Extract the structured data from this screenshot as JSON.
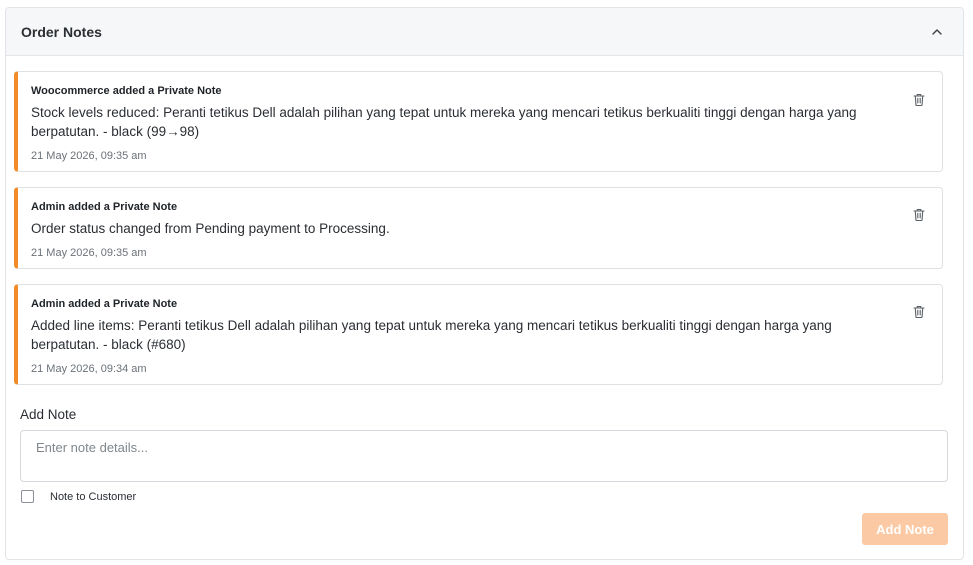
{
  "panel": {
    "title": "Order Notes"
  },
  "notes": [
    {
      "author": "Woocommerce added a Private Note",
      "text": "Stock levels reduced: Peranti tetikus Dell adalah pilihan yang tepat untuk mereka yang mencari tetikus berkualiti tinggi dengan harga yang berpatutan. - black (99→98)",
      "time": "21 May 2026, 09:35 am"
    },
    {
      "author": "Admin added a Private Note",
      "text": "Order status changed from Pending payment to Processing.",
      "time": "21 May 2026, 09:35 am"
    },
    {
      "author": "Admin added a Private Note",
      "text": "Added line items: Peranti tetikus Dell adalah pilihan yang tepat untuk mereka yang mencari tetikus berkualiti tinggi dengan harga yang berpatutan. - black (#680)",
      "time": "21 May 2026, 09:34 am"
    }
  ],
  "add_note": {
    "label": "Add Note",
    "placeholder": "Enter note details...",
    "value": "",
    "customer_checkbox_label": "Note to Customer",
    "customer_checked": false,
    "button_label": "Add Note",
    "button_enabled": false
  },
  "icons": {
    "collapse": "chevron-up-icon",
    "delete": "trash-icon"
  },
  "colors": {
    "accent": "#f28c28",
    "button_disabled": "#fbc9a4",
    "header_bg": "#f6f7f8"
  }
}
